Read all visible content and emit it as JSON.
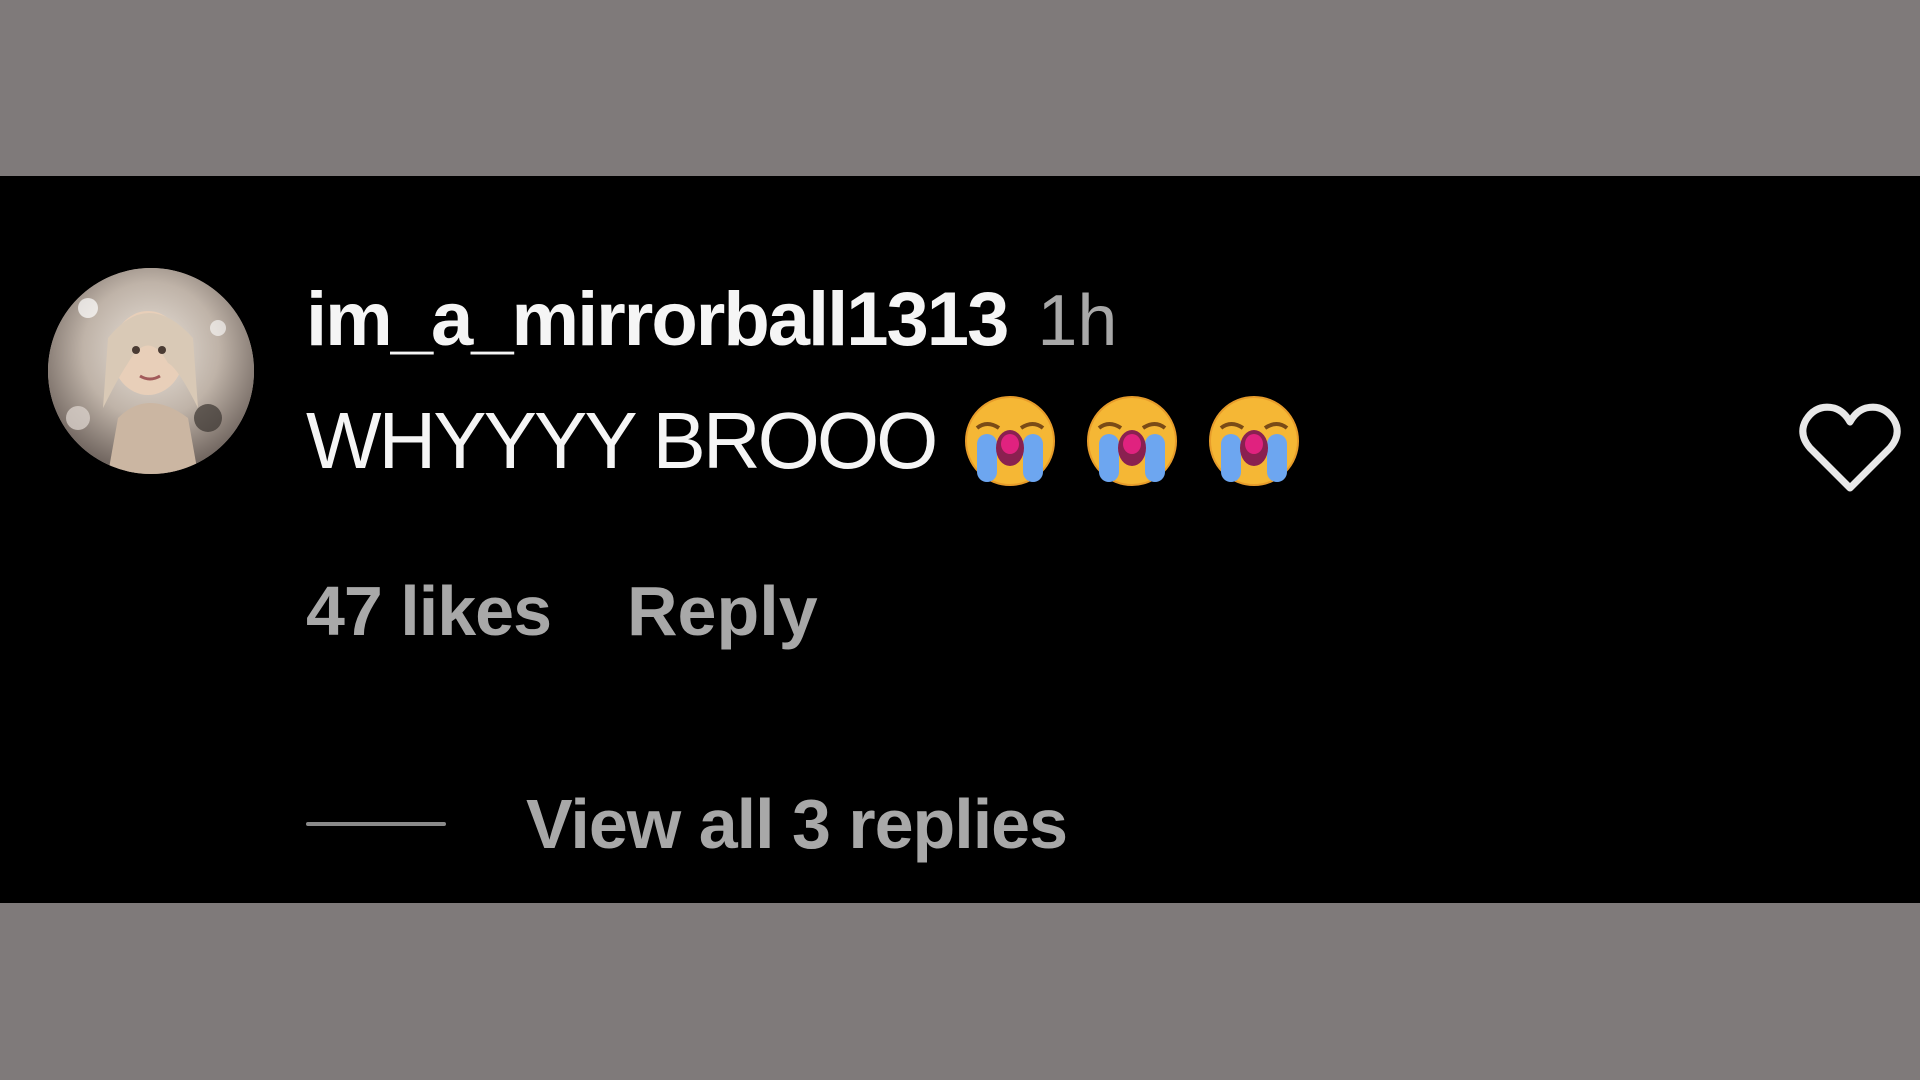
{
  "comment": {
    "username": "im_a_mirrorball1313",
    "timestamp": "1h",
    "text": "WHYYYY BROOO",
    "emojis": [
      "loudly-crying-face-emoji",
      "loudly-crying-face-emoji",
      "loudly-crying-face-emoji"
    ],
    "likes": "47 likes",
    "reply_label": "Reply",
    "view_replies_label": "View all 3 replies",
    "like_icon": "heart-outline-icon"
  },
  "colors": {
    "background_frame": "#7f7a7a",
    "panel_background": "#000000",
    "primary_text": "#f5f5f5",
    "secondary_text": "#a8a8a8"
  }
}
